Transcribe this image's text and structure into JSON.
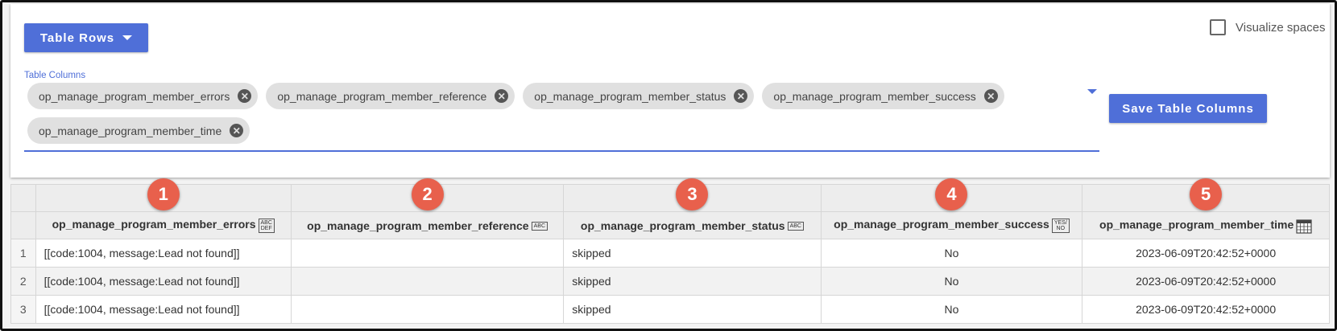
{
  "toolbar": {
    "table_rows_label": "Table Rows",
    "save_columns_label": "Save Table Columns",
    "visualize_spaces_label": "Visualize spaces",
    "visualize_spaces_checked": false
  },
  "columns_field": {
    "label": "Table Columns",
    "chips": [
      "op_manage_program_member_errors",
      "op_manage_program_member_reference",
      "op_manage_program_member_status",
      "op_manage_program_member_success",
      "op_manage_program_member_time"
    ]
  },
  "table": {
    "markers": [
      "1",
      "2",
      "3",
      "4",
      "5"
    ],
    "headers": [
      {
        "name": "op_manage_program_member_errors",
        "type_icon": "ABC DEF"
      },
      {
        "name": "op_manage_program_member_reference",
        "type_icon": "ABC"
      },
      {
        "name": "op_manage_program_member_status",
        "type_icon": "ABC"
      },
      {
        "name": "op_manage_program_member_success",
        "type_icon": "YES/ NO"
      },
      {
        "name": "op_manage_program_member_time",
        "type_icon": "calendar-icon"
      }
    ],
    "rows": [
      {
        "index": "1",
        "errors": "[[code:1004, message:Lead not found]]",
        "reference": "",
        "status": "skipped",
        "success": "No",
        "time": "2023-06-09T20:42:52+0000"
      },
      {
        "index": "2",
        "errors": "[[code:1004, message:Lead not found]]",
        "reference": "",
        "status": "skipped",
        "success": "No",
        "time": "2023-06-09T20:42:52+0000"
      },
      {
        "index": "3",
        "errors": "[[code:1004, message:Lead not found]]",
        "reference": "",
        "status": "skipped",
        "success": "No",
        "time": "2023-06-09T20:42:52+0000"
      }
    ]
  },
  "colors": {
    "accent": "#4f6fd8",
    "marker": "#e8604c",
    "chip_bg": "#e0e0e0"
  }
}
